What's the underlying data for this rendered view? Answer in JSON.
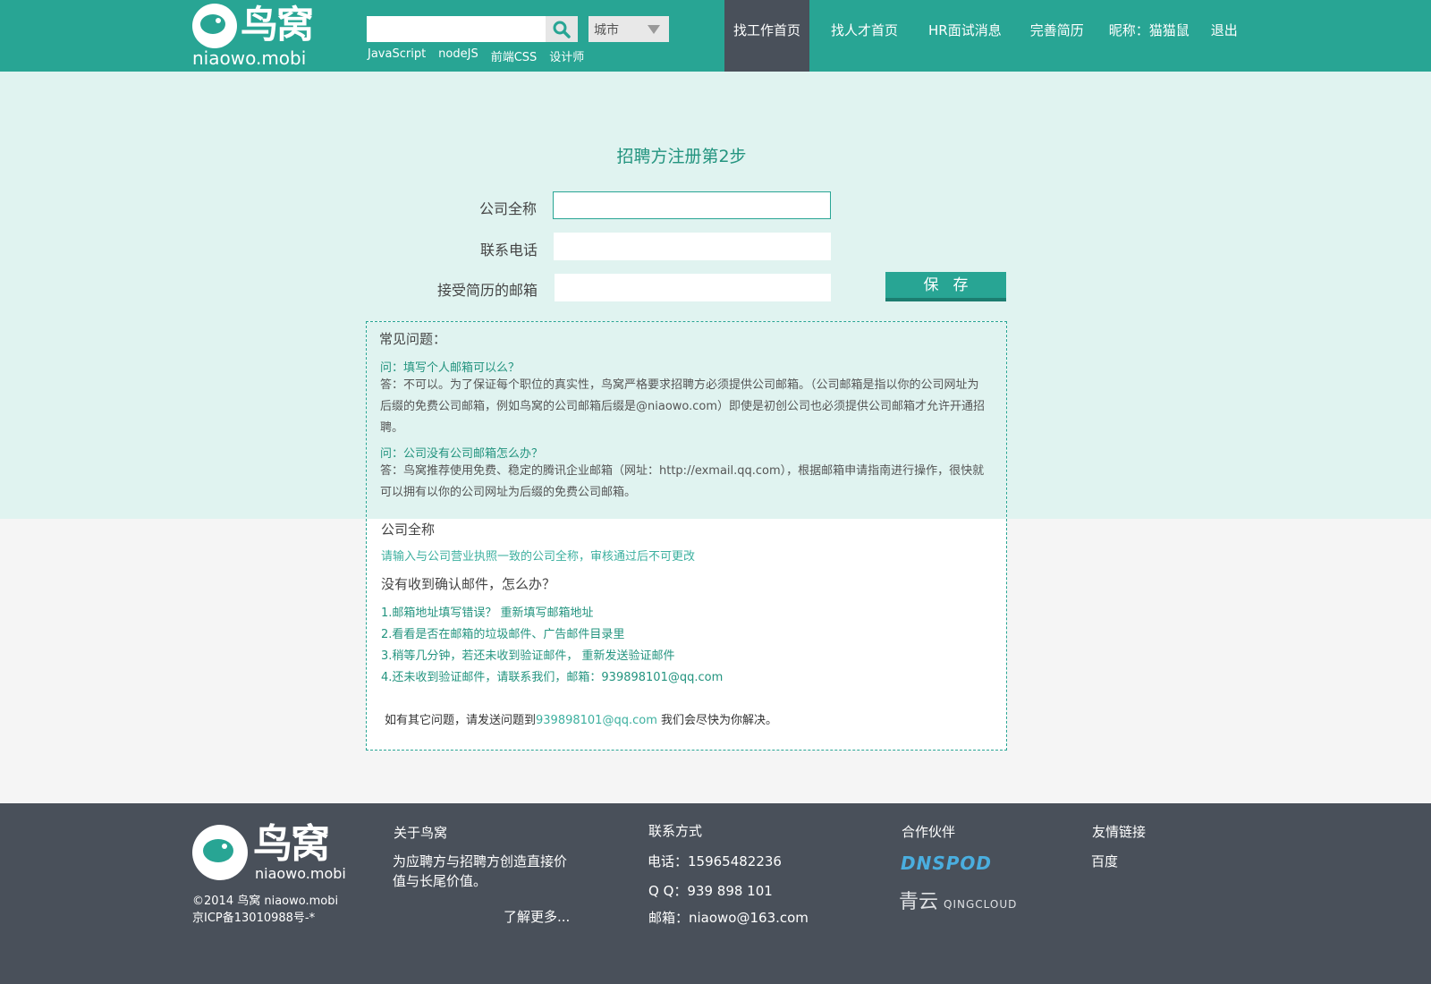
{
  "header": {
    "logo_cn": "鸟窝",
    "logo_en": "niaowo.mobi",
    "search": {
      "value": "",
      "placeholder": ""
    },
    "city": "城市",
    "hot_tags": [
      "JavaScript",
      "nodeJS",
      "前端CSS",
      "设计师"
    ],
    "nav": [
      "找工作首页",
      "找人才首页",
      "HR面试消息",
      "完善简历",
      "昵称：猫猫鼠",
      "退出"
    ],
    "nav_active": "找工作首页"
  },
  "form": {
    "title": "招聘方注册第2步",
    "company_label": "公司全称",
    "phone_label": "联系电话",
    "email_label": "接受简历的邮箱",
    "company_value": "",
    "phone_value": "",
    "email_value": "",
    "save_label": "保存"
  },
  "faq": {
    "heading": "常见问题：",
    "q1": "问：填写个人邮箱可以么？",
    "a1": "答：不可以。为了保证每个职位的真实性，鸟窝严格要求招聘方必须提供公司邮箱。（公司邮箱是指以你的公司网址为后缀的免费公司邮箱，例如鸟窝的公司邮箱后缀是@niaowo.com）即使是初创公司也必须提供公司邮箱才允许开通招聘。",
    "q2": "问：公司没有公司邮箱怎么办？",
    "a2": "答：鸟窝推荐使用免费、稳定的腾讯企业邮箱（网址：http://exmail.qq.com），根据邮箱申请指南进行操作，很快就可以拥有以你的公司网址为后缀的免费公司邮箱。",
    "company_title": "公司全称",
    "company_note": "请输入与公司营业执照一致的公司全称，审核通过后不可更改",
    "no_email_title": "没有收到确认邮件，怎么办？",
    "steps": [
      "1.邮箱地址填写错误？ 重新填写邮箱地址",
      "2.看看是否在邮箱的垃圾邮件、广告邮件目录里",
      "3.稍等几分钟，若还未收到验证邮件， 重新发送验证邮件",
      "4.还未收到验证邮件，请联系我们，邮箱：939898101@qq.com"
    ],
    "contact_prefix": "如有其它问题，请发送问题到",
    "contact_email": "939898101@qq.com",
    "contact_suffix": " 我们会尽快为你解决。"
  },
  "footer": {
    "logo_cn": "鸟窝",
    "logo_en": "niaowo.mobi",
    "copyright": "©2014 鸟窝 niaowo.mobi",
    "icp": "京ICP备13010988号-*",
    "about_title": "关于鸟窝",
    "about_text": "为应聘方与招聘方创造直接价值与长尾价值。",
    "more_link": "了解更多...",
    "contact_title": "联系方式",
    "phone": "电话：15965482236",
    "qq": "Q Q：939 898 101",
    "email": "邮箱：niaowo@163.com",
    "partners_title": "合作伙伴",
    "partner1": "DNSPOD",
    "partner2_cn": "青云",
    "partner2_en": "QINGCLOUD",
    "links_title": "友情链接",
    "link1": "百度"
  },
  "colors": {
    "brand": "#28a594",
    "light_band": "#e0f3f0",
    "footer_bg": "#49505a",
    "nav_active_bg": "#49505a"
  }
}
